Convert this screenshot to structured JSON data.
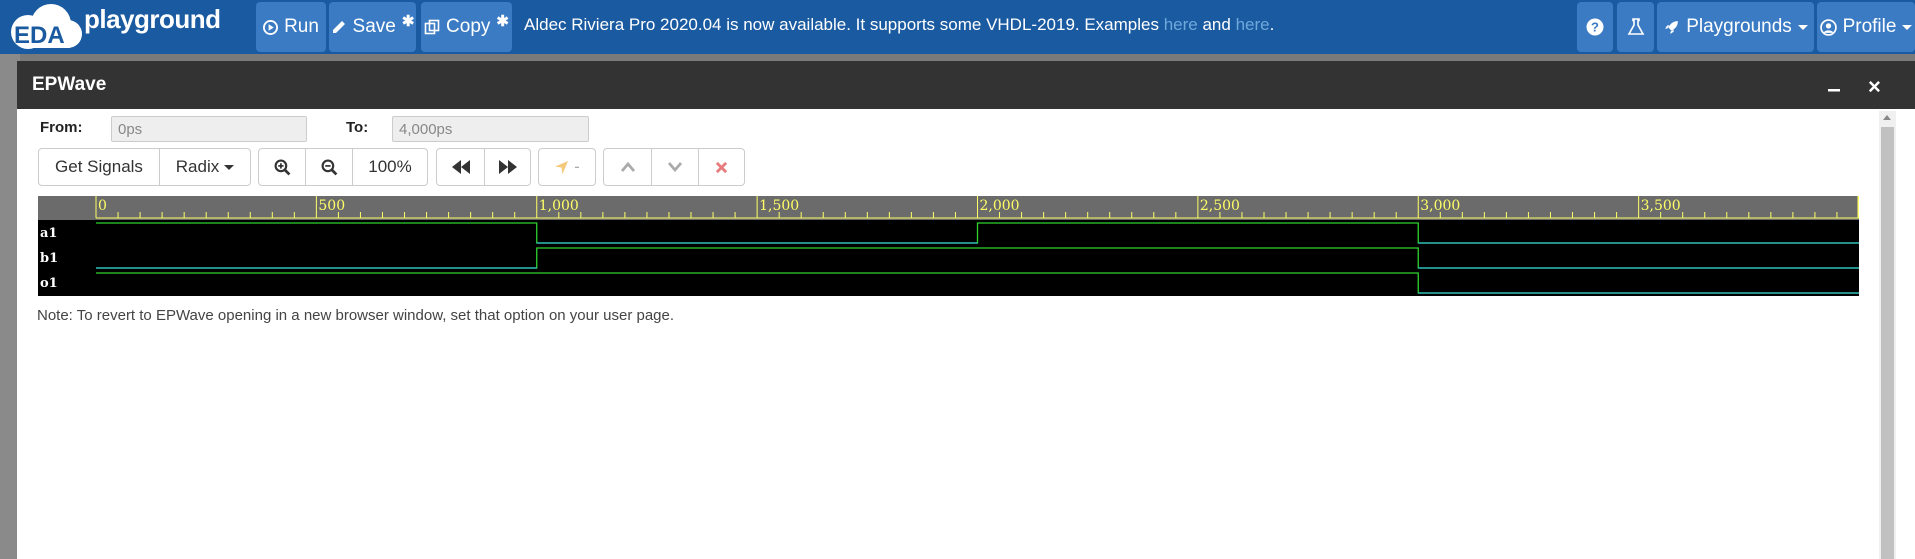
{
  "navbar": {
    "logo_text": "playground",
    "logo_badge": "EDA",
    "run_label": "Run",
    "save_label": "Save",
    "save_mark": "✱",
    "copy_label": "Copy",
    "copy_mark": "✱",
    "announcement": "Aldec Riviera Pro 2020.04 is now available. It supports some VHDL-2019. Examples ",
    "link1": "here",
    "conj": " and ",
    "link2": "here",
    "period": ".",
    "playgrounds_label": "Playgrounds",
    "profile_label": "Profile",
    "bg_color": "#1a5aa0"
  },
  "modal": {
    "title": "EPWave",
    "from_label": "From:",
    "from_value": "0ps",
    "to_label": "To:",
    "to_value": "4,000ps",
    "toolbar": {
      "get_signals": "Get Signals",
      "radix": "Radix",
      "zoom_level": "100%",
      "marker_dash": "-"
    },
    "note": "Note: To revert to EPWave opening in a new browser window, set that option on your user page."
  },
  "wave": {
    "time_range": [
      0,
      4000
    ],
    "ticks": [
      "0",
      "500",
      "1,000",
      "1,500",
      "2,000",
      "2,500",
      "3,000",
      "3,500"
    ],
    "tick_values": [
      0,
      500,
      1000,
      1500,
      2000,
      2500,
      3000,
      3500
    ],
    "signals": [
      {
        "name": "a1",
        "color": "#2fd12f",
        "transitions": [
          [
            0,
            1
          ],
          [
            1000,
            0
          ],
          [
            2000,
            1
          ],
          [
            3000,
            0
          ]
        ]
      },
      {
        "name": "b1",
        "color": "#2fd12f",
        "transitions": [
          [
            0,
            0
          ],
          [
            1000,
            1
          ],
          [
            3000,
            0
          ]
        ]
      },
      {
        "name": "o1",
        "color": "#2fd12f",
        "transitions": [
          [
            0,
            1
          ],
          [
            3000,
            0
          ]
        ]
      }
    ]
  }
}
